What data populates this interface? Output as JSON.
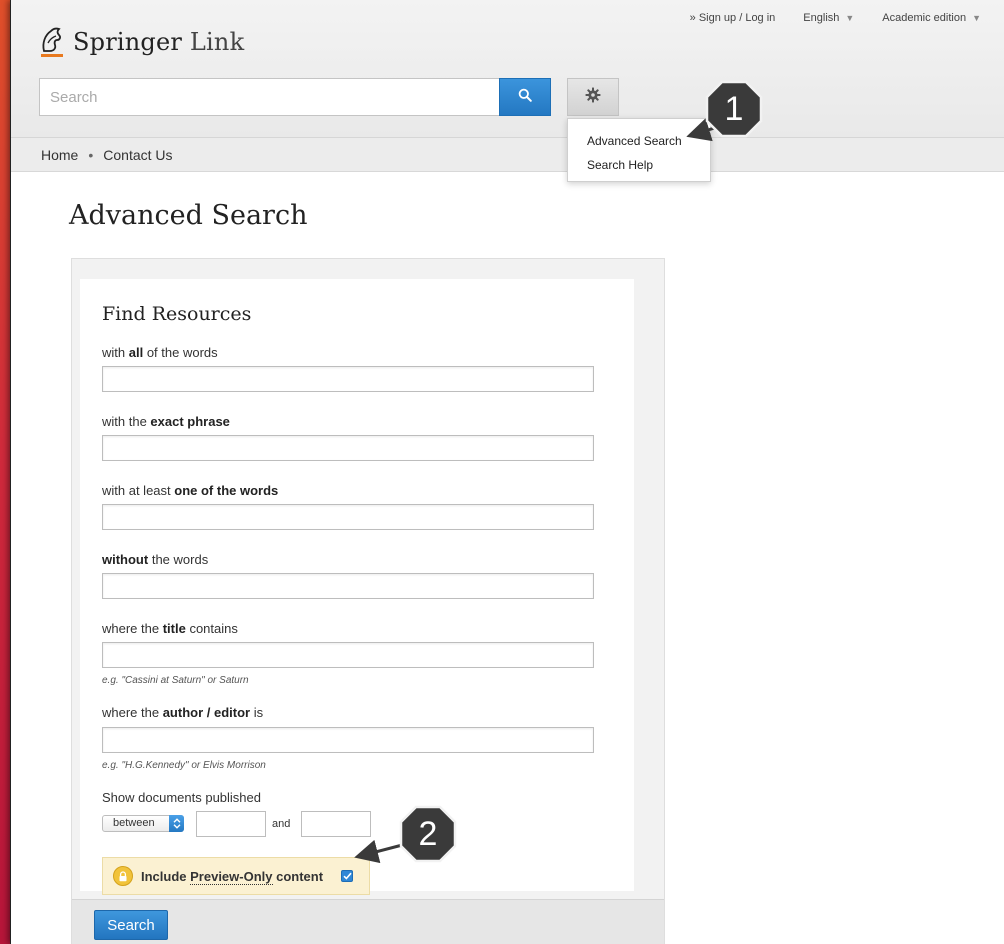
{
  "header": {
    "logo_brand": "Springer",
    "logo_suffix": "Link",
    "top_links": {
      "signup": "» Sign up / Log in",
      "language": "English",
      "edition": "Academic edition"
    },
    "search": {
      "placeholder": "Search",
      "value": ""
    }
  },
  "nav": {
    "home": "Home",
    "separator": "•",
    "contact": "Contact Us"
  },
  "settings_menu": {
    "items": [
      {
        "label": "Advanced Search"
      },
      {
        "label": "Search Help"
      }
    ]
  },
  "callouts": {
    "one": "1",
    "two": "2"
  },
  "page": {
    "title": "Advanced Search"
  },
  "form": {
    "section_title": "Find Resources",
    "all_words": {
      "pre": "with ",
      "bold": "all",
      "post": " of the words",
      "value": ""
    },
    "exact_phrase": {
      "pre": "with the ",
      "bold": "exact phrase",
      "post": "",
      "value": ""
    },
    "one_of_words": {
      "pre": "with at least ",
      "bold": "one of the words",
      "post": "",
      "value": ""
    },
    "without_words": {
      "pre": "",
      "bold": "without",
      "post": " the words",
      "value": ""
    },
    "title": {
      "pre": "where the ",
      "bold": "title",
      "post": " contains",
      "value": "",
      "hint": "e.g. \"Cassini at Saturn\" or Saturn"
    },
    "author": {
      "pre": "where the ",
      "bold": "author / editor",
      "post": " is",
      "value": "",
      "hint": "e.g. \"H.G.Kennedy\" or Elvis Morrison"
    },
    "published": {
      "label": "Show documents published",
      "mode": "between",
      "from": "",
      "and_label": "and",
      "to": ""
    },
    "preview": {
      "label_pre": "Include ",
      "label_link": "Preview-Only",
      "label_post": " content",
      "checked": true
    },
    "submit_label": "Search"
  },
  "colors": {
    "accent_blue": "#2478c2",
    "brand_orange": "#e8791f",
    "callout_gray": "#3a3a3a",
    "preview_bg": "#fbf1d2"
  }
}
